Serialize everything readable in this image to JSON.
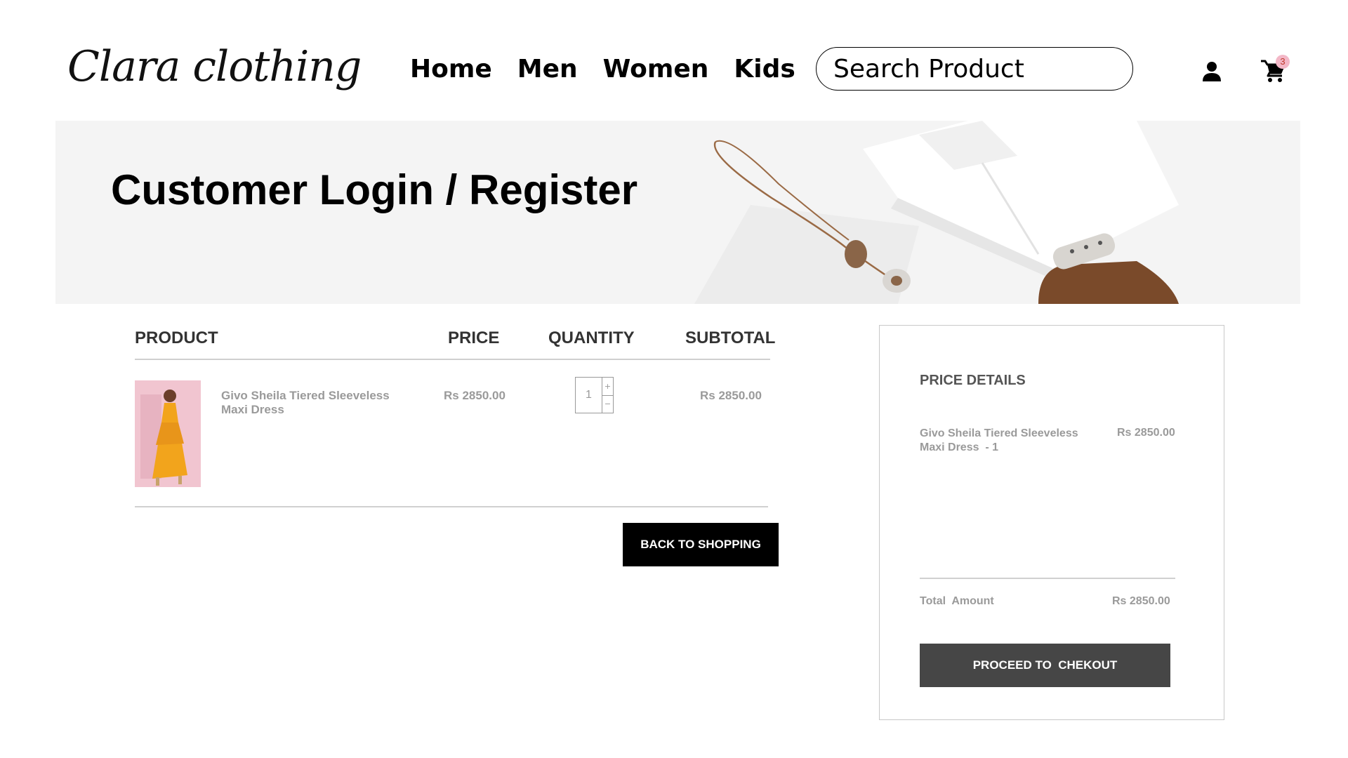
{
  "header": {
    "logo_text": "Clara clothing",
    "nav": [
      "Home",
      "Men",
      "Women",
      "Kids"
    ],
    "search_placeholder": "Search Product",
    "cart_count": "3",
    "icons": {
      "user": "user-icon",
      "cart": "cart-icon"
    }
  },
  "banner": {
    "title": "Customer Login / Register"
  },
  "cart": {
    "headers": {
      "product": "PRODUCT",
      "price": "PRICE",
      "quantity": "QUANTITY",
      "subtotal": "SUBTOTAL"
    },
    "items": [
      {
        "name_line1": "Givo Sheila Tiered Sleeveless",
        "name_line2": "Maxi Dress",
        "price": "Rs 2850.00",
        "quantity": "1",
        "subtotal": "Rs 2850.00"
      }
    ],
    "qty_plus": "+",
    "qty_minus": "−",
    "back_button": "BACK TO SHOPPING"
  },
  "price_details": {
    "title": "PRICE DETAILS",
    "item_line1": "Givo Sheila Tiered Sleeveless",
    "item_line2": "Maxi Dress  - 1",
    "item_price": "Rs 2850.00",
    "total_label": "Total  Amount",
    "total_value": "Rs 2850.00",
    "checkout_button": "PROCEED TO  CHEKOUT"
  },
  "colors": {
    "banner_bg": "#f4f4f4",
    "back_button_bg": "#000000",
    "checkout_button_bg": "#464646",
    "badge_bg": "#f3b7c7",
    "product_image_bg": "#f1c5d0",
    "dress": "#f2a41c"
  }
}
